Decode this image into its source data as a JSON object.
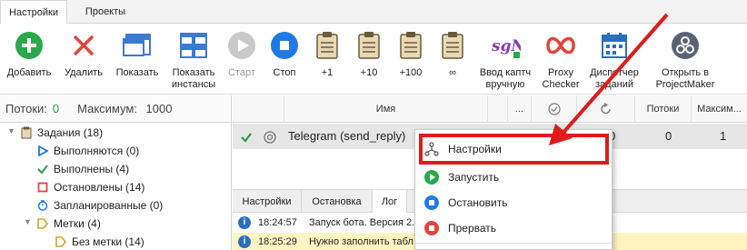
{
  "tabs": [
    {
      "label": "Настройки",
      "active": true
    },
    {
      "label": "Проекты",
      "active": false
    }
  ],
  "ribbon": {
    "add": "Добавить",
    "delete": "Удалить",
    "show": "Показать",
    "show_instances": "Показать инстансы",
    "start": "Старт",
    "stop": "Стоп",
    "plus1": "+1",
    "plus10": "+10",
    "plus100": "+100",
    "infinity": "∞",
    "captcha": "Ввод каптч вручную",
    "proxy": "Proxy Checker",
    "scheduler": "Диспетчер заданий",
    "projectmaker": "Открыть в ProjectMaker"
  },
  "left": {
    "threads_label": "Потоки:",
    "threads_value": "0",
    "max_label": "Максимум:",
    "max_value": "1000",
    "tree": [
      {
        "label": "Задания (18)",
        "icon": "clipboard-icon"
      },
      {
        "label": "Выполняются (0)",
        "icon": "play-icon"
      },
      {
        "label": "Выполнены (4)",
        "icon": "check-icon"
      },
      {
        "label": "Остановлены (14)",
        "icon": "stop-square-icon"
      },
      {
        "label": "Запланированные (0)",
        "icon": "clock-icon"
      },
      {
        "label": "Метки (4)",
        "icon": "tag-icon"
      },
      {
        "label": "Без метки (14)",
        "icon": "tag-icon"
      }
    ]
  },
  "grid": {
    "columns": [
      "Имя",
      "...",
      "Потоки",
      "Максим..."
    ],
    "row": {
      "name": "Telegram (send_reply)",
      "col_partial": "0",
      "threads": "0",
      "max": "1"
    }
  },
  "bottom_tabs": [
    {
      "label": "Настройки",
      "active": false
    },
    {
      "label": "Остановка",
      "active": false
    },
    {
      "label": "Лог",
      "active": true
    }
  ],
  "log": [
    {
      "time": "18:24:57",
      "text": "Запуск бота. Версия 2.",
      "level": "info"
    },
    {
      "time": "18:25:29",
      "text": "Нужно заполнить табл",
      "level": "warn"
    }
  ],
  "context_menu": {
    "items": [
      {
        "label": "Настройки",
        "icon": "settings-node-icon",
        "highlighted": true
      },
      {
        "label": "Запустить",
        "icon": "play-icon"
      },
      {
        "label": "Остановить",
        "icon": "stop-icon"
      },
      {
        "label": "Прервать",
        "icon": "abort-icon"
      }
    ]
  },
  "colors": {
    "highlight": "#e01b1b",
    "green": "#2a9d48",
    "blue": "#2b6fbf"
  }
}
